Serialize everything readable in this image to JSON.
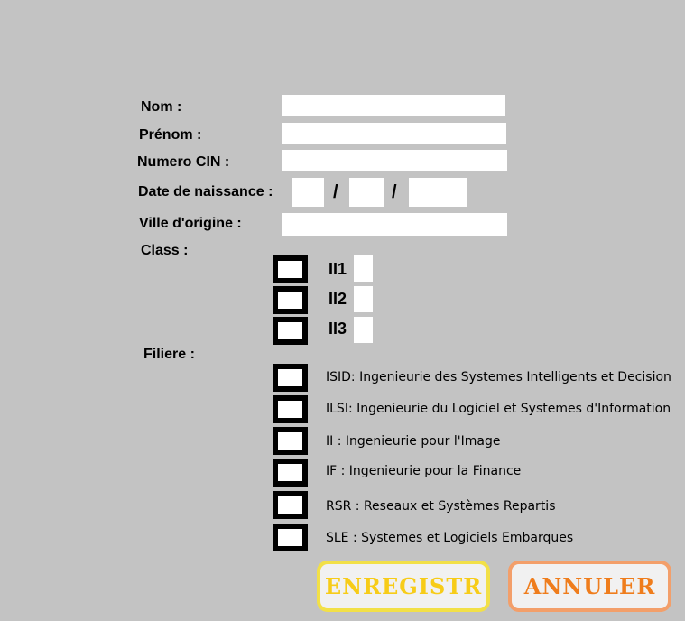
{
  "form": {
    "nom": {
      "label": "Nom  :",
      "value": ""
    },
    "prenom": {
      "label": "Prénom :",
      "value": ""
    },
    "cin": {
      "label": "Numero CIN :",
      "value": ""
    },
    "dob": {
      "label": "Date de naissance :",
      "day": "",
      "month": "",
      "year": "",
      "sep1": "/",
      "sep2": "/"
    },
    "ville": {
      "label": "Ville d'origine :",
      "value": ""
    }
  },
  "class_section": {
    "label": "Class :",
    "options": [
      {
        "label": "II1"
      },
      {
        "label": "II2"
      },
      {
        "label": "II3"
      }
    ]
  },
  "filiere_section": {
    "label": "Filiere :",
    "options": [
      {
        "label": "ISID: Ingenieurie des Systemes Intelligents et Decision"
      },
      {
        "label": "ILSI: Ingenieurie du Logiciel et Systemes d'Information"
      },
      {
        "label": "II  : Ingenieurie pour l'Image"
      },
      {
        "label": "IF  : Ingenieurie pour la Finance"
      },
      {
        "label": "RSR : Reseaux et Systèmes Repartis"
      },
      {
        "label": "SLE : Systemes et Logiciels Embarques"
      }
    ]
  },
  "buttons": {
    "save_label": "ENREGISTR",
    "cancel_label": "ANNULER"
  },
  "colors": {
    "background": "#c3c3c3",
    "save_text": "#f7cc18",
    "save_border": "#f2e047",
    "cancel_text": "#ef7d1c",
    "cancel_border": "#f39f6a"
  }
}
